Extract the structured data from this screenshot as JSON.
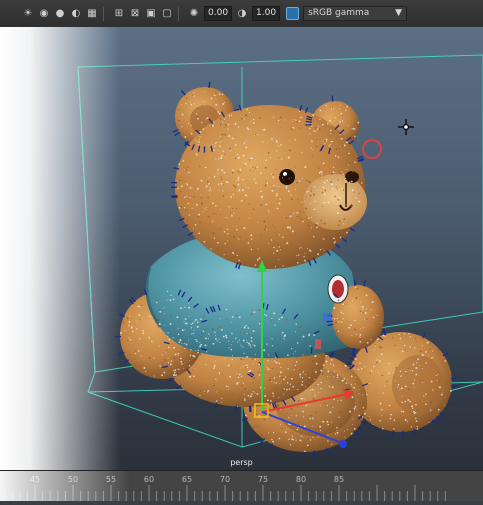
{
  "toolbar": {
    "icons": [
      "sun-light-icon",
      "camera-icon",
      "sphere-icon",
      "sphere-shaded-icon",
      "selection-icon",
      "xray-icon",
      "wireframe-icon",
      "layout-icon",
      "snapshot-icon",
      "exposure-icon",
      "gamma-icon",
      "colorspace-icon"
    ],
    "exposure_value": "0.00",
    "gamma_value": "1.00",
    "color_space": "sRGB gamma"
  },
  "viewport": {
    "camera_label": "persp",
    "accent_bounding_box": "#3fe0c5",
    "gizmo_colors": {
      "x": "#e83a2b",
      "y": "#2fd34a",
      "z": "#2a3fe0",
      "pivot": "#f2c21b"
    },
    "fur_color": "#c98b4b",
    "shirt_color": "#4d95a6"
  },
  "timeline": {
    "ticks": [
      "45",
      "50",
      "55",
      "60",
      "65",
      "70",
      "75",
      "80",
      "85"
    ]
  }
}
